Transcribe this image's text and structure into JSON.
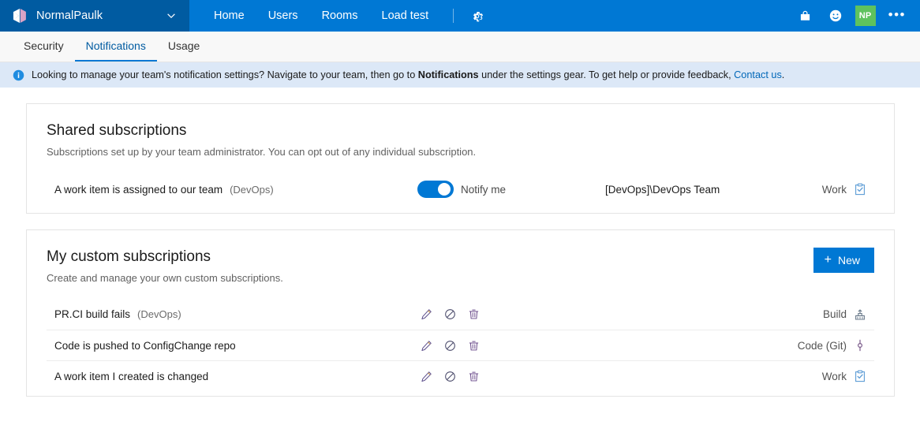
{
  "header": {
    "org_name": "NormalPaulk",
    "org_chevron_icon": "chevron-down-icon",
    "logo_icon": "azure-devops-logo",
    "nav_items": [
      {
        "label": "Home"
      },
      {
        "label": "Users"
      },
      {
        "label": "Rooms"
      },
      {
        "label": "Load test"
      }
    ],
    "settings_icon": "gear-icon",
    "marketplace_icon": "shopping-bag-icon",
    "feedback_icon": "smiley-face-icon",
    "avatar_initials": "NP",
    "avatar_color": "#5ec25e",
    "more_label": "•••",
    "bar_color": "#0078d4",
    "org_block_color": "#005ba1"
  },
  "tabs": [
    {
      "label": "Security",
      "active": false
    },
    {
      "label": "Notifications",
      "active": true
    },
    {
      "label": "Usage",
      "active": false
    }
  ],
  "banner": {
    "icon": "info-icon",
    "text_1": "Looking to manage your team's notification settings? Navigate to your team, then go to ",
    "bold_1": "Notifications",
    "text_2": " under the settings gear. To get help or provide feedback, ",
    "link": "Contact us",
    "text_3": ".",
    "background": "#dce8f7"
  },
  "shared_card": {
    "title": "Shared subscriptions",
    "subtitle": "Subscriptions set up by your team administrator. You can opt out of any individual subscription.",
    "rows": [
      {
        "description": "A work item is assigned to our team",
        "scope": "(DevOps)",
        "toggle_on": true,
        "toggle_label": "Notify me",
        "team": "[DevOps]\\DevOps Team",
        "category": "Work",
        "category_icon": "work-item-icon"
      }
    ]
  },
  "custom_card": {
    "title": "My custom subscriptions",
    "subtitle": "Create and manage your own custom subscriptions.",
    "new_button": "New",
    "new_button_icon": "plus-icon",
    "new_button_color": "#0078d4",
    "row_actions": [
      {
        "name": "edit-icon",
        "tooltip": "Edit"
      },
      {
        "name": "disable-icon",
        "tooltip": "Disable"
      },
      {
        "name": "delete-icon",
        "tooltip": "Delete"
      }
    ],
    "rows": [
      {
        "description": "PR.CI build fails",
        "scope": "(DevOps)",
        "category": "Build",
        "category_icon": "build-icon"
      },
      {
        "description": "Code is pushed to ConfigChange repo",
        "scope": "",
        "category": "Code (Git)",
        "category_icon": "git-commit-icon"
      },
      {
        "description": "A work item I created is changed",
        "scope": "",
        "category": "Work",
        "category_icon": "work-item-icon"
      }
    ]
  }
}
